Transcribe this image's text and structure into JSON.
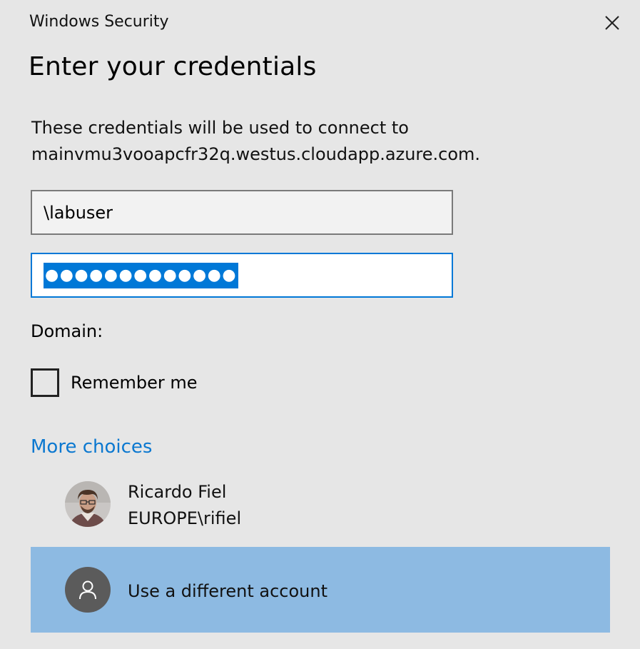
{
  "window": {
    "title": "Windows Security",
    "close_icon": "close-icon"
  },
  "dialog": {
    "heading": "Enter your credentials",
    "description_line1": "These credentials will be used to connect to",
    "description_line2": "mainvmu3vooapcfr32q.westus.cloudapp.azure.com."
  },
  "form": {
    "username_value": "\\labuser",
    "password_masked": "●●●●●●●●●●●●●",
    "domain_label": "Domain:",
    "remember_label": "Remember me",
    "remember_checked": false
  },
  "more_choices": {
    "label": "More choices",
    "accounts": [
      {
        "name": "Ricardo Fiel",
        "domain": "EUROPE\\rifiel",
        "icon": "user-photo-avatar"
      },
      {
        "label": "Use a different account",
        "icon": "person-icon",
        "selected": true
      }
    ]
  },
  "colors": {
    "background": "#e6e6e6",
    "accent": "#0078d7",
    "link": "#0b78d0",
    "selected_row": "#8dbae2"
  }
}
